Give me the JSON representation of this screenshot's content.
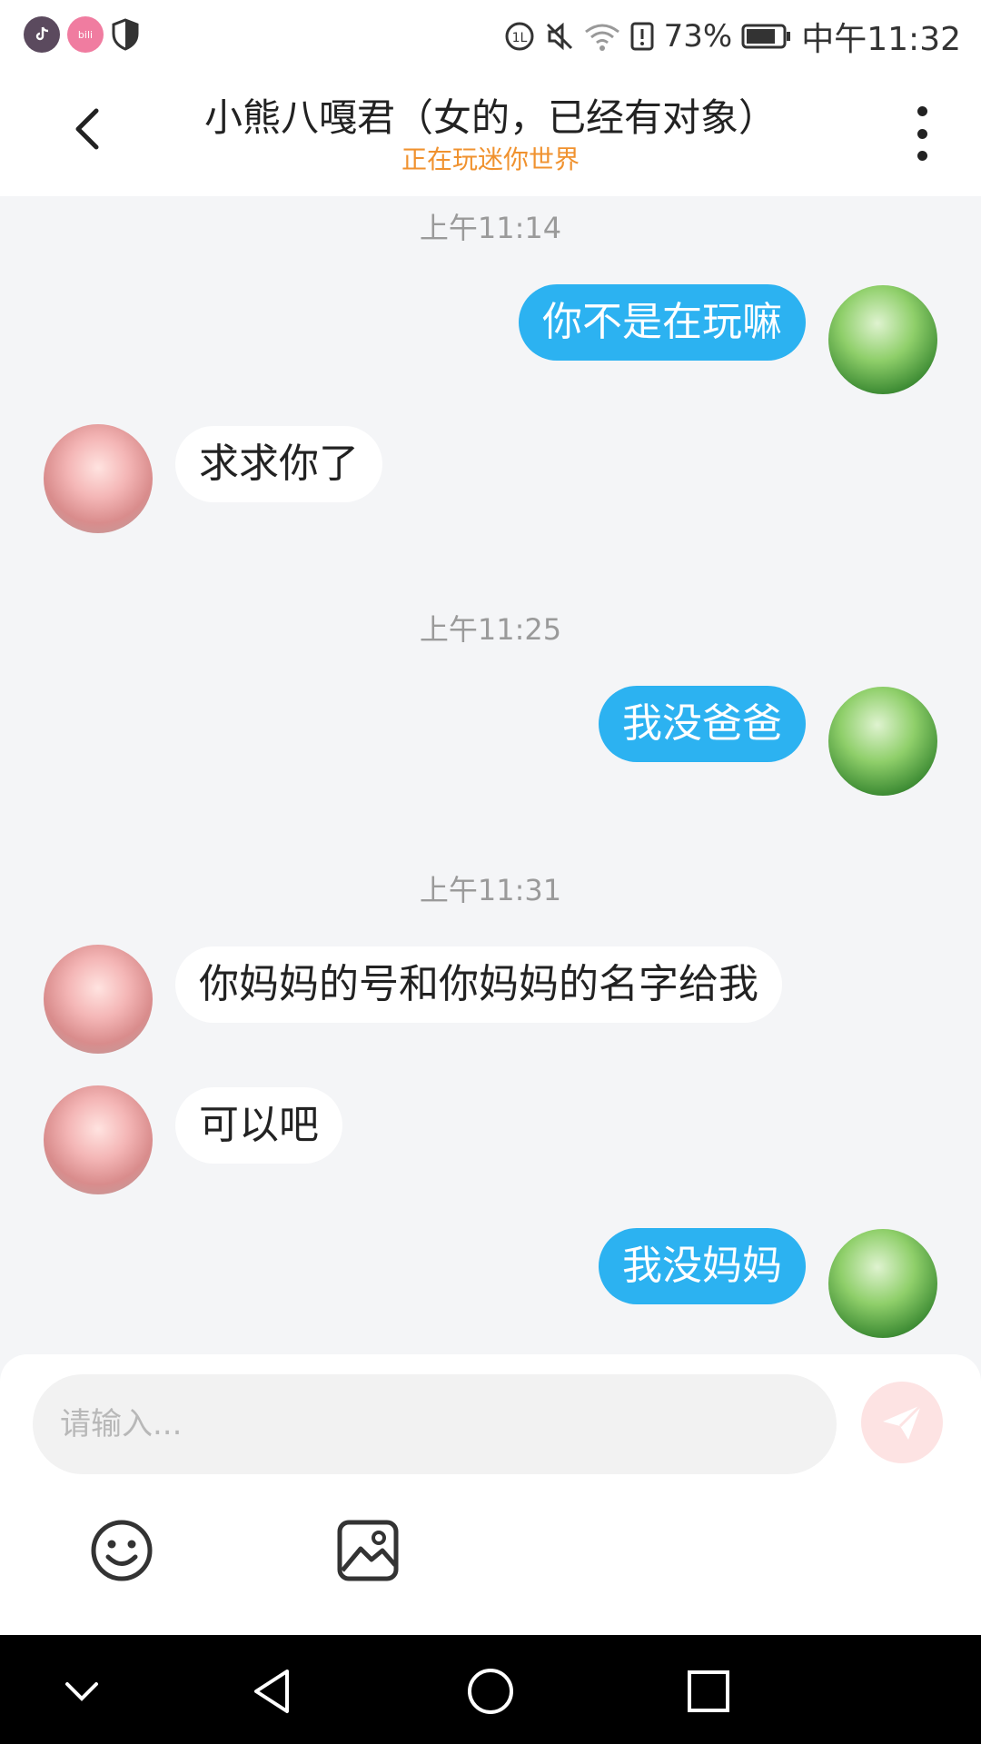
{
  "status_bar": {
    "battery_percent": "73%",
    "time": "中午11:32",
    "left_apps": [
      "tiktok-icon",
      "bilibili-icon",
      "shield-icon"
    ],
    "bilibili_label": "bili",
    "right_icons": [
      "hd-icon",
      "mute-icon",
      "wifi-icon",
      "alert-icon",
      "battery-icon"
    ]
  },
  "header": {
    "title": "小熊八嘎君（女的，已经有对象）",
    "subtitle": "正在玩迷你世界",
    "back_icon": "chevron-left-icon",
    "more_icon": "more-vertical-icon",
    "subtitle_color": "#f0922f"
  },
  "messages": [
    {
      "type": "timestamp",
      "text": "上午11:14"
    },
    {
      "type": "message",
      "from": "me",
      "text": "你不是在玩嘛"
    },
    {
      "type": "message",
      "from": "them",
      "text": "求求你了"
    },
    {
      "type": "timestamp",
      "text": "上午11:25"
    },
    {
      "type": "message",
      "from": "me",
      "text": "我没爸爸"
    },
    {
      "type": "timestamp",
      "text": "上午11:31"
    },
    {
      "type": "message",
      "from": "them",
      "text": "你妈妈的号和你妈妈的名字给我"
    },
    {
      "type": "message",
      "from": "them",
      "text": "可以吧"
    },
    {
      "type": "message",
      "from": "me",
      "text": "我没妈妈"
    }
  ],
  "input": {
    "placeholder": "请输入...",
    "value": "",
    "send_icon": "send-icon",
    "tools": [
      "emoji-icon",
      "image-icon"
    ]
  },
  "nav_bar": {
    "buttons": [
      "chevron-down-icon",
      "back-triangle-icon",
      "home-circle-icon",
      "recents-square-icon"
    ]
  },
  "colors": {
    "my_bubble": "#2cb2f1",
    "their_bubble": "#ffffff",
    "chat_background": "#f4f5f7",
    "send_button": "#fde3e3"
  }
}
